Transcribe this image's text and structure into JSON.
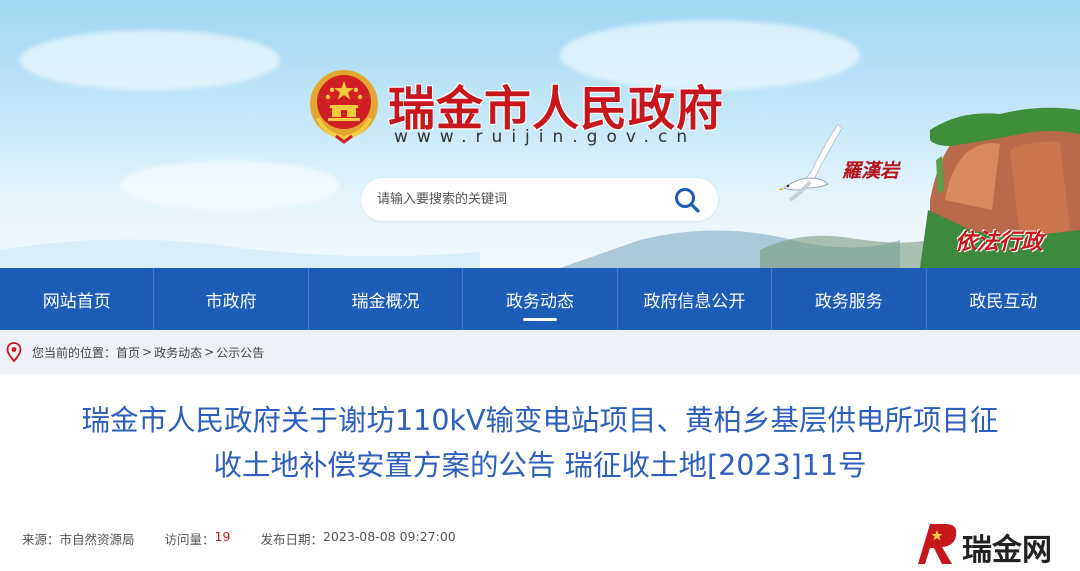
{
  "header": {
    "site_title": "瑞金市人民政府",
    "site_url": "www.ruijin.gov.cn",
    "search_placeholder": "请输入要搜索的关键词",
    "calligraphy_1": "羅漢岩",
    "calligraphy_2": "依法行政"
  },
  "nav": {
    "items": [
      {
        "label": "网站首页"
      },
      {
        "label": "市政府"
      },
      {
        "label": "瑞金概况"
      },
      {
        "label": "政务动态",
        "active": true
      },
      {
        "label": "政府信息公开"
      },
      {
        "label": "政务服务"
      },
      {
        "label": "政民互动"
      }
    ]
  },
  "breadcrumb": {
    "prefix": "您当前的位置：",
    "items": [
      "首页",
      "政务动态",
      "公示公告"
    ],
    "separator": ">"
  },
  "article": {
    "title_line1": "瑞金市人民政府关于谢坊110kV输变电站项目、黄柏乡基层供电所项目征",
    "title_line2": "收土地补偿安置方案的公告 瑞征收土地[2023]11号",
    "source_label": "来源：",
    "source_value": "市自然资源局",
    "views_label": "访问量：",
    "views_value": "19",
    "date_label": "发布日期：",
    "date_value": "2023-08-08 09:27:00"
  },
  "watermark": {
    "text": "瑞金网"
  },
  "colors": {
    "nav_bg": "#1d5db8",
    "title_blue": "#2d5fbd",
    "brand_red": "#c8161d",
    "crumb_bg": "#eef1f6"
  }
}
